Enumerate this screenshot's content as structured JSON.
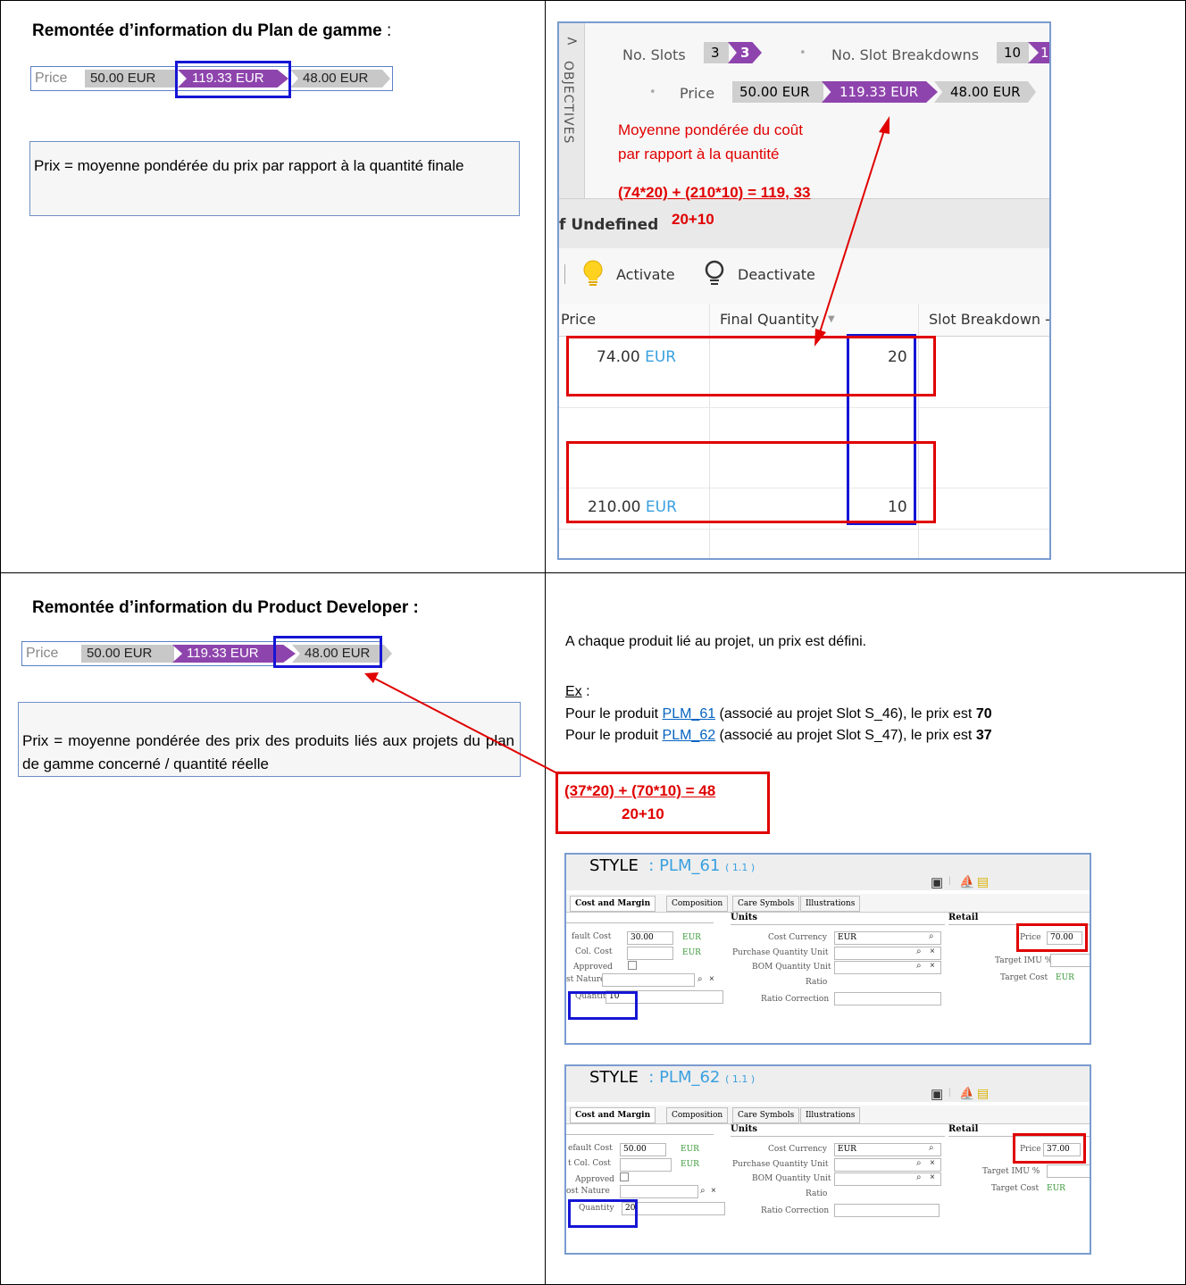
{
  "plan_section": {
    "heading": "Remontée d’information du Plan de gamme",
    "heading_suffix": " :",
    "price_bar": {
      "label": "Price",
      "v1": "50.00 EUR",
      "v2": "119.33 EUR",
      "v3": "48.00 EUR"
    },
    "note": "Prix = moyenne pondérée du prix par rapport à la quantité finale"
  },
  "objectives_panel": {
    "side_label": "OBJECTIVES",
    "chevron": ">",
    "slots_label": "No. Slots",
    "slots_v1": "3",
    "slots_v2": "3",
    "breakdowns_label": "No. Slot Breakdowns",
    "breakdowns_v1": "10",
    "breakdowns_v2": "1",
    "bullet": "•",
    "price_label": "Price",
    "price_v1": "50.00 EUR",
    "price_v2": "119.33 EUR",
    "price_v3": "48.00 EUR",
    "annotation_line1": "Moyenne pondérée du coût",
    "annotation_line2": "par rapport à la quantité",
    "formula_numerator": "(74*20) + (210*10) = 119, 33",
    "formula_denominator": "20+10",
    "group_title": "f Undefined",
    "activate_label": "Activate",
    "deactivate_label": "Deactivate",
    "col_price": "Price",
    "col_final_quantity": "Final Quantity",
    "col_slot_breakdown": "Slot Breakdown -",
    "rows": [
      {
        "price": "74.00",
        "currency": "EUR",
        "quantity": "20"
      },
      {
        "price": "210.00",
        "currency": "EUR",
        "quantity": "10"
      }
    ]
  },
  "pd_section": {
    "heading": "Remontée d’information du Product Developer :",
    "price_bar": {
      "label": "Price",
      "v1": "50.00 EUR",
      "v2": "119.33 EUR",
      "v3": "48.00 EUR"
    },
    "note": "Prix = moyenne pondérée des prix des produits liés aux projets du plan de gamme concerné / quantité réelle"
  },
  "pd_right": {
    "intro": "A chaque produit lié au projet, un prix est défini.",
    "ex_label": "Ex",
    "ex_colon": " :",
    "line1_prefix": "Pour le produit ",
    "line1_link": "PLM_61",
    "line1_middle": " (associé au projet Slot S_46), le prix est ",
    "line1_value": "70",
    "line2_prefix": "Pour le produit ",
    "line2_link": "PLM_62",
    "line2_middle": " (associé au projet Slot S_47), le prix est ",
    "line2_value": "37",
    "formula_numerator": "(37*20) + (70*10) = 48",
    "formula_denominator": "20+10"
  },
  "style_windows": [
    {
      "title": "STYLE",
      "code": ": PLM_61",
      "version": "( 1.1 )",
      "tabs": [
        "Cost and Margin",
        "Composition",
        "Care Symbols",
        "Illustrations"
      ],
      "units_header": "Units",
      "retail_header": "Retail",
      "default_cost_label": "fault Cost",
      "default_cost": "30.00",
      "col_cost_label": "Col. Cost",
      "approved_label": "Approved",
      "cost_nature_label": "st Nature",
      "quantity_label": "Quantity",
      "quantity": "10",
      "eur": "EUR",
      "cost_currency_label": "Cost Currency",
      "cost_currency": "EUR",
      "purchase_qty_label": "Purchase Quantity Unit",
      "bom_qty_label": "BOM Quantity Unit",
      "ratio_label": "Ratio",
      "ratio_correction_label": "Ratio Correction",
      "price_label": "Price",
      "price": "70.00",
      "target_imu_label": "Target IMU %",
      "target_cost_label": "Target Cost",
      "target_cost": "EUR"
    },
    {
      "title": "STYLE",
      "code": ": PLM_62",
      "version": "( 1.1 )",
      "tabs": [
        "Cost and Margin",
        "Composition",
        "Care Symbols",
        "Illustrations"
      ],
      "units_header": "Units",
      "retail_header": "Retail",
      "default_cost_label": "efault Cost",
      "default_cost": "50.00",
      "col_cost_label": "t Col. Cost",
      "approved_label": "Approved",
      "cost_nature_label": "ost Nature",
      "quantity_label": "Quantity",
      "quantity": "20",
      "eur": "EUR",
      "cost_currency_label": "Cost Currency",
      "cost_currency": "EUR",
      "purchase_qty_label": "Purchase Quantity Unit",
      "bom_qty_label": "BOM Quantity Unit",
      "ratio_label": "Ratio",
      "ratio_correction_label": "Ratio Correction",
      "price_label": "Price",
      "price": "37.00",
      "target_imu_label": "Target IMU %",
      "target_cost_label": "Target Cost",
      "target_cost": "EUR"
    }
  ],
  "colors": {
    "red": "#e00000",
    "blue": "#1515d5",
    "purple": "#8e44ad",
    "grey": "#c8c8c8",
    "link": "#0563c1"
  }
}
